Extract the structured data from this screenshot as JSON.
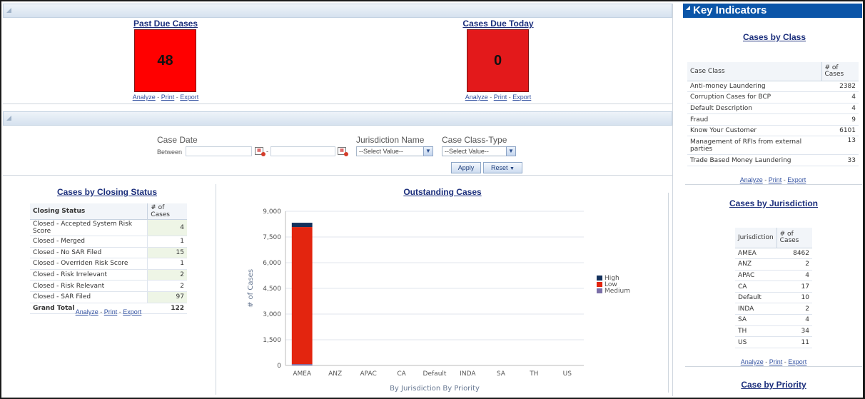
{
  "past_due": {
    "title": "Past Due Cases",
    "value": "48",
    "color": "#ff0000"
  },
  "due_today": {
    "title": "Cases Due Today",
    "value": "0",
    "color": "#e3191b"
  },
  "links": {
    "analyze": "Analyze",
    "print": "Print",
    "export": "Export",
    "sep": "-"
  },
  "filters": {
    "case_date_label": "Case Date",
    "between_label": "Between",
    "date_separator": "-",
    "jurisdiction_label": "Jurisdiction Name",
    "jurisdiction_value": "--Select Value--",
    "class_type_label": "Case Class-Type",
    "class_type_value": "--Select Value--",
    "apply_label": "Apply",
    "reset_label": "Reset"
  },
  "closing_status": {
    "title": "Cases by Closing Status",
    "headers": [
      "Closing Status",
      "# of Cases"
    ],
    "rows": [
      [
        "Closed - Accepted System Risk Score",
        "4"
      ],
      [
        "Closed - Merged",
        "1"
      ],
      [
        "Closed - No SAR Filed",
        "15"
      ],
      [
        "Closed - Overriden Risk Score",
        "1"
      ],
      [
        "Closed - Risk Irrelevant",
        "2"
      ],
      [
        "Closed - Risk Relevant",
        "2"
      ],
      [
        "Closed - SAR Filed",
        "97"
      ]
    ],
    "total": [
      "Grand Total",
      "122"
    ]
  },
  "outstanding": {
    "title": "Outstanding Cases"
  },
  "chart_data": {
    "type": "bar",
    "stacked": true,
    "title": "Outstanding Cases",
    "xlabel": "By Jurisdiction By Priority",
    "ylabel": "# of Cases",
    "categories": [
      "AMEA",
      "ANZ",
      "APAC",
      "CA",
      "Default",
      "INDA",
      "SA",
      "TH",
      "US"
    ],
    "series": [
      {
        "name": "Medium",
        "color": "#7b6fa8",
        "values": [
          80,
          0,
          0,
          0,
          0,
          0,
          0,
          0,
          0
        ]
      },
      {
        "name": "Low",
        "color": "#e3250f",
        "values": [
          8000,
          0,
          0,
          0,
          0,
          0,
          0,
          0,
          0
        ]
      },
      {
        "name": "High",
        "color": "#14315c",
        "values": [
          250,
          0,
          0,
          0,
          0,
          0,
          0,
          0,
          0
        ]
      }
    ],
    "legend_order": [
      "High",
      "Low",
      "Medium"
    ],
    "yticks": [
      "0",
      "1,500",
      "3,000",
      "4,500",
      "6,000",
      "7,500",
      "9,000"
    ],
    "ylim": [
      0,
      9000
    ],
    "grid": true,
    "legend": "right"
  },
  "key_indicators": {
    "title": "Key Indicators",
    "by_class": {
      "title": "Cases by Class",
      "headers": [
        "Case Class",
        "# of Cases"
      ],
      "rows": [
        [
          "Anti-money Laundering",
          "2382"
        ],
        [
          "Corruption Cases for BCP",
          "4"
        ],
        [
          "Default Description",
          "4"
        ],
        [
          "Fraud",
          "9"
        ],
        [
          "Know Your Customer",
          "6101"
        ],
        [
          "Management of RFIs from external parties",
          "13"
        ],
        [
          "Trade Based Money Laundering",
          "33"
        ]
      ]
    },
    "by_jurisdiction": {
      "title": "Cases by Jurisdiction",
      "headers": [
        "Jurisdiction",
        "# of Cases"
      ],
      "rows": [
        [
          "AMEA",
          "8462"
        ],
        [
          "ANZ",
          "2"
        ],
        [
          "APAC",
          "4"
        ],
        [
          "CA",
          "17"
        ],
        [
          "Default",
          "10"
        ],
        [
          "INDA",
          "2"
        ],
        [
          "SA",
          "4"
        ],
        [
          "TH",
          "34"
        ],
        [
          "US",
          "11"
        ]
      ]
    },
    "by_priority": {
      "title": "Case by Priority"
    }
  }
}
